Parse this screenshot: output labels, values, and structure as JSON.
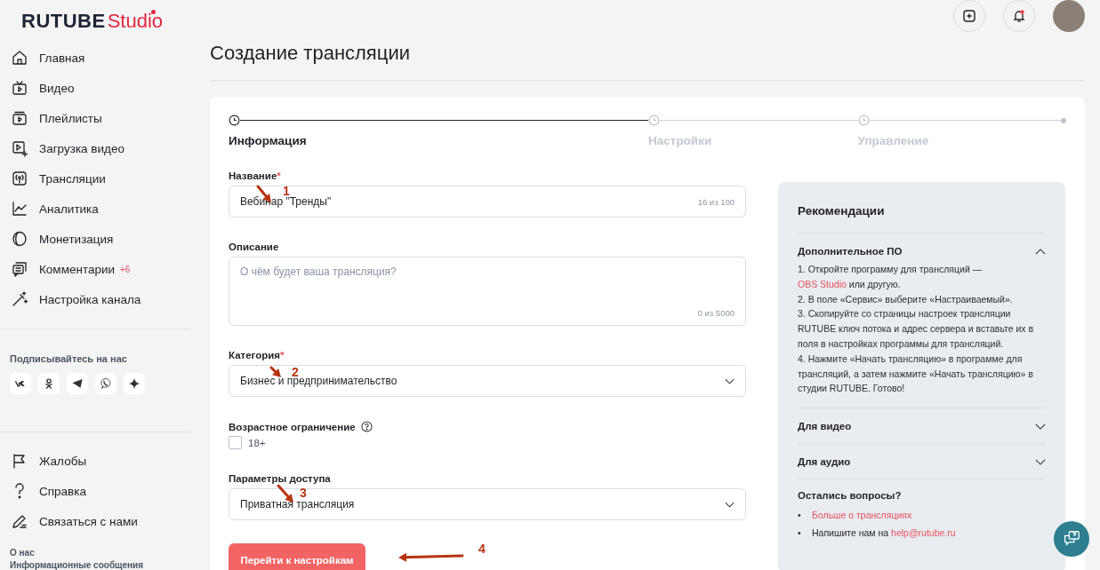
{
  "logo": {
    "brand": "RUTUBE",
    "product": "Studio"
  },
  "sidebar": {
    "items": [
      {
        "label": "Главная"
      },
      {
        "label": "Видео"
      },
      {
        "label": "Плейлисты"
      },
      {
        "label": "Загрузка видео"
      },
      {
        "label": "Трансляции"
      },
      {
        "label": "Аналитика"
      },
      {
        "label": "Монетизация"
      },
      {
        "label": "Комментарии",
        "badge": "+6"
      },
      {
        "label": "Настройка канала"
      }
    ],
    "social_title": "Подписывайтесь на нас",
    "bottom_items": [
      {
        "label": "Жалобы"
      },
      {
        "label": "Справка"
      },
      {
        "label": "Связаться с нами"
      }
    ],
    "footer_links": [
      "О нас",
      "Информационные сообщения"
    ]
  },
  "page_title": "Создание трансляции",
  "steps": [
    {
      "label": "Информация",
      "selected": true
    },
    {
      "label": "Настройки",
      "selected": false
    },
    {
      "label": "Управление",
      "selected": false
    }
  ],
  "form": {
    "name": {
      "label": "Название",
      "required_mark": "*",
      "value": "Вебинар \"Тренды\"",
      "counter": "16 из 100"
    },
    "description": {
      "label": "Описание",
      "placeholder": "О чём будет ваша трансляция?",
      "counter": "0 из 5000"
    },
    "category": {
      "label": "Категория",
      "required_mark": "*",
      "value": "Бизнес и предпринимательство"
    },
    "age": {
      "label": "Возрастное ограничение",
      "option": "18+",
      "checked": false
    },
    "access": {
      "label": "Параметры доступа",
      "value": "Приватная трансляция"
    },
    "submit": "Перейти к настройкам"
  },
  "recommendations": {
    "title": "Рекомендации",
    "sections": [
      {
        "title": "Дополнительное ПО",
        "expanded": true,
        "lines": [
          {
            "text": "1. Откройте программу для трансляций —"
          },
          {
            "link": "OBS Studio",
            "text": "или другую."
          },
          {
            "text": "2. В поле «Сервис» выберите «Настраиваемый»."
          },
          {
            "text": "3. Скопируйте со страницы настроек трансляции RUTUBE ключ потока и адрес сервера и вставьте их в поля в настройках программы для трансляций."
          },
          {
            "text": "4. Нажмите «Начать трансляцию» в программе для трансляций, а затем нажмите «Начать трансляцию» в студии RUTUBE. Готово!"
          }
        ]
      },
      {
        "title": "Для видео",
        "expanded": false
      },
      {
        "title": "Для аудио",
        "expanded": false
      }
    ],
    "questions_title": "Остались вопросы?",
    "questions": [
      {
        "bullet": "•",
        "link": "Больше о трансляциях"
      },
      {
        "bullet": "•",
        "text": "Напишите нам на",
        "link": "help@rutube.ru"
      }
    ]
  },
  "annotations": [
    {
      "number": "1"
    },
    {
      "number": "2"
    },
    {
      "number": "3"
    },
    {
      "number": "4"
    }
  ]
}
